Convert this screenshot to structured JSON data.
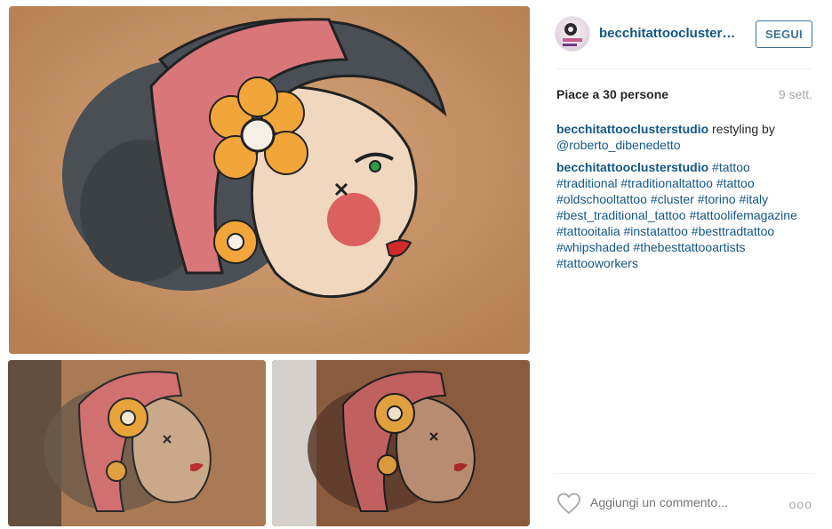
{
  "post": {
    "username": "becchitattooclusterst...",
    "follow_label": "SEGUI",
    "likes_text": "Piace a 30 persone",
    "time_ago": "9 sett."
  },
  "comments": [
    {
      "user": "becchitattooclusterstudio",
      "text": " restyling by ",
      "mentions": [
        "@roberto_dibenedetto"
      ]
    },
    {
      "user": "becchitattooclusterstudio",
      "hashtags": [
        "#tattoo",
        "#traditional",
        "#traditionaltattoo",
        "#tattoo",
        "#oldschooltattoo",
        "#cluster",
        "#torino",
        "#italy",
        "#best_traditional_tattoo",
        "#tattoolifemagazine",
        "#tattooitalia",
        "#instatattoo",
        "#besttradtattoo",
        "#whipshaded",
        "#thebesttattooartists",
        "#tattooworkers"
      ]
    }
  ],
  "comment_box": {
    "placeholder": "Aggiungi un commento...",
    "more_label": "ooo"
  },
  "icons": {
    "like": "heart-outline-icon",
    "more": "more-options-icon"
  },
  "colors": {
    "link": "#125688",
    "follow_border": "#3f729b",
    "muted": "#a5a7aa"
  }
}
